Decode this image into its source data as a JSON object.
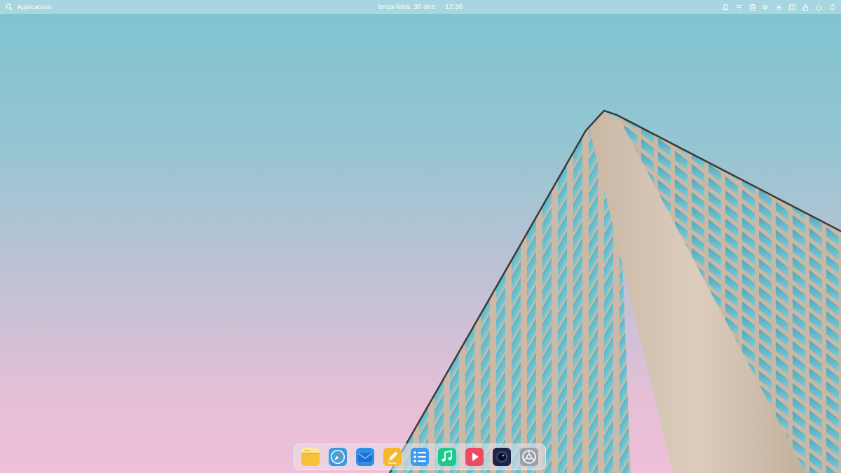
{
  "top_panel": {
    "apps_label": "Applications",
    "date": "terça-feira, 30 dez.",
    "time": "12:36",
    "tray_icons": [
      "bell-icon",
      "network-icon",
      "clipboard-icon",
      "volume-icon",
      "brightness-icon",
      "keyboard-icon",
      "lock-icon",
      "power-icon",
      "refresh-icon"
    ]
  },
  "dock": {
    "items": [
      {
        "name": "files",
        "icon": "folder-icon",
        "color": "#f7c23b"
      },
      {
        "name": "browser",
        "icon": "compass-icon",
        "color": "#3a9bdc"
      },
      {
        "name": "mail",
        "icon": "envelope-icon",
        "color": "#2f8fe6"
      },
      {
        "name": "notes",
        "icon": "pencil-icon",
        "color": "#f6b72e"
      },
      {
        "name": "tasks",
        "icon": "list-icon",
        "color": "#3a9bf0"
      },
      {
        "name": "music",
        "icon": "music-note-icon",
        "color": "#1fc98a"
      },
      {
        "name": "video",
        "icon": "play-icon",
        "color": "#f04a63"
      },
      {
        "name": "camera",
        "icon": "camera-lens-icon",
        "color": "#1c2346"
      },
      {
        "name": "settings",
        "icon": "gear-icon",
        "color": "#9aa0a8"
      }
    ]
  }
}
